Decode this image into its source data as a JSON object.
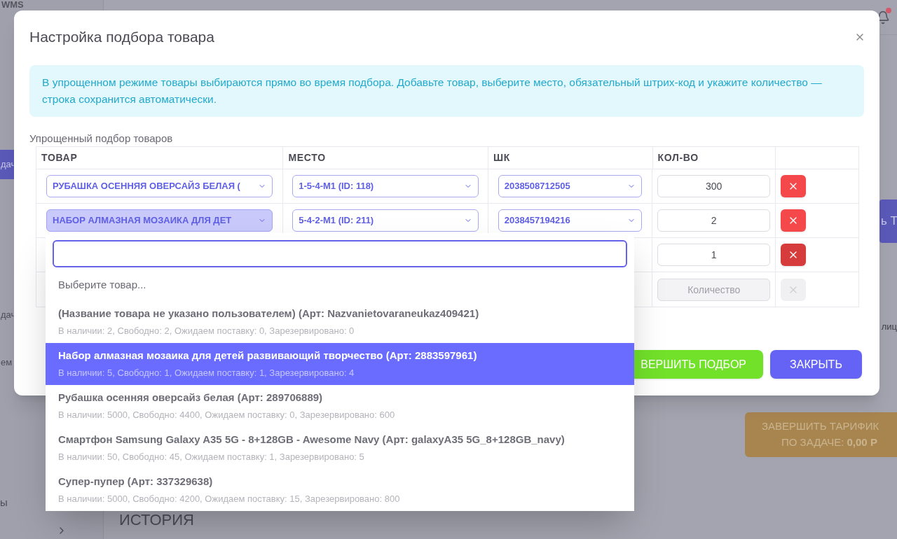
{
  "app": {
    "logo": "WMS",
    "sidebar_texts": [
      "дач",
      "дач",
      "ем",
      "ы"
    ],
    "right_button": "ь Т",
    "right_text": "лиц",
    "history_title": "ИСТОРИЯ",
    "tariff_button": {
      "lines": [
        "ЗАВЕРШИТЬ ТАРИФИК",
        "ПО ЗАДАЧЕ: **0,00 Р**"
      ]
    }
  },
  "modal": {
    "title": "Настройка подбора товара",
    "info": "В упрощенном режиме товары выбираются прямо во время подбора. Добавьте товар, выберите место, обязательный штрих-код и укажите количество — строка сохранится автоматически.",
    "section_label": "Упрощенный подбор товаров",
    "columns": [
      "ТОВАР",
      "МЕСТО",
      "ШК",
      "КОЛ-ВО"
    ],
    "rows": [
      {
        "product": {
          "value": "РУБАШКА ОСЕННЯЯ ОВЕРСАЙЗ БЕЛАЯ (",
          "open": false
        },
        "place": "1-5-4-M1 (ID: 118)",
        "barcode": "2038508712505",
        "quantity": {
          "value": "300"
        },
        "delete": {
          "disabled": false,
          "hovered": false
        }
      },
      {
        "product": {
          "value": "НАБОР АЛМАЗНАЯ МОЗАИКА ДЛЯ ДЕТ",
          "open": true
        },
        "place": "5-4-2-M1 (ID: 211)",
        "barcode": "2038457194216",
        "quantity": {
          "value": "2"
        },
        "delete": {
          "disabled": false,
          "hovered": false
        }
      },
      {
        "quantity": {
          "value": "1"
        },
        "delete": {
          "disabled": false,
          "hovered": true
        }
      },
      {
        "quantity": {
          "placeholder": "Количество"
        },
        "delete": {
          "disabled": true,
          "hovered": false
        }
      }
    ],
    "buttons": [
      {
        "label": "ВЕРШИТЬ ПОДБОР",
        "kind": "success"
      },
      {
        "label": "ЗАКРЫТЬ",
        "kind": "primary"
      }
    ]
  },
  "dropdown": {
    "placeholder_option": "Выберите товар...",
    "options": [
      {
        "name": "(Название товара не указано пользователем) (Арт: Nazvanietovaraneukaz409421)",
        "stock": "В наличии: 2, Свободно: 2, Ожидаем поставку: 0, Зарезервировано: 0",
        "selected": false
      },
      {
        "name": "Набор алмазная мозаика для детей развивающий творчество (Арт: 2883597961)",
        "stock": "В наличии: 5, Свободно: 1, Ожидаем поставку: 1, Зарезервировано: 4",
        "selected": true
      },
      {
        "name": "Рубашка осенняя оверсайз белая (Арт: 289706889)",
        "stock": "В наличии: 5000, Свободно: 4400, Ожидаем поставку: 0, Зарезервировано: 600",
        "selected": false
      },
      {
        "name": "Смартфон Samsung Galaxy A35 5G - 8+128GB - Awesome Navy (Арт: galaxyA35 5G_8+128GB_navy)",
        "stock": "В наличии: 50, Свободно: 45, Ожидаем поставку: 1, Зарезервировано: 5",
        "selected": false
      },
      {
        "name": "Супер-пупер (Арт: 337329638)",
        "stock": "В наличии: 5000, Свободно: 4200, Ожидаем поставку: 15, Зарезервировано: 800",
        "selected": false
      }
    ]
  }
}
